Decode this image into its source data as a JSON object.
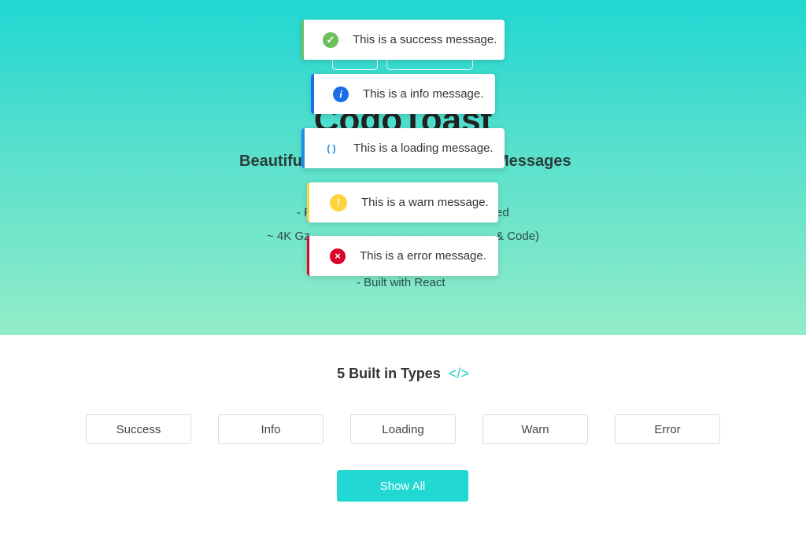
{
  "hero": {
    "title": "CogoToast",
    "subtitle_left": "Beautifu",
    "subtitle_right": "Messages",
    "feature1_left": "- F",
    "feature1_right": "ed",
    "feature2_left": "~ 4K Gz",
    "feature2_right": "& Code)",
    "feature3": "- Built with React"
  },
  "toasts": [
    {
      "type": "success",
      "message": "This is a success message.",
      "color": "#6ec05f",
      "icon": "check-circle-icon"
    },
    {
      "type": "info",
      "message": "This is a info message.",
      "color": "#1c6ee8",
      "icon": "info-circle-icon"
    },
    {
      "type": "loading",
      "message": "This is a loading message.",
      "color": "#1c8ee8",
      "icon": "spinner-icon"
    },
    {
      "type": "warn",
      "message": "This is a warn message.",
      "color": "#fcd43e",
      "icon": "exclamation-circle-icon"
    },
    {
      "type": "error",
      "message": "This is a error message.",
      "color": "#d9042a",
      "icon": "x-circle-icon"
    }
  ],
  "types_section": {
    "title": "5 Built in Types",
    "code_icon": "</>",
    "buttons": [
      "Success",
      "Info",
      "Loading",
      "Warn",
      "Error"
    ],
    "show_all": "Show All"
  },
  "colors": {
    "accent": "#22d8d3"
  }
}
